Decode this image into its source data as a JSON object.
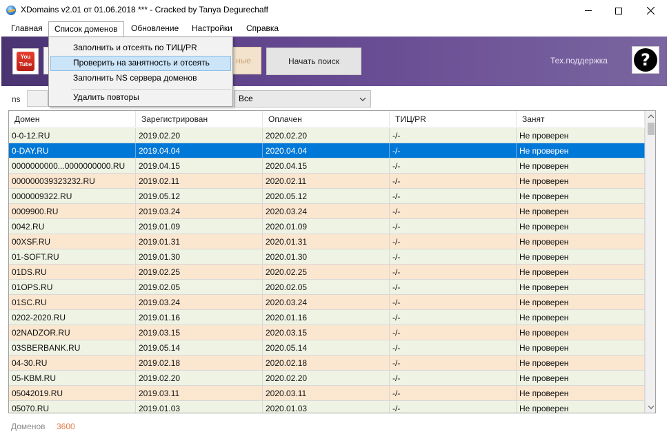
{
  "window": {
    "title": "XDomains v2.01 от 01.06.2018 *** - Cracked by Tanya Degurechaff"
  },
  "menubar": {
    "items": [
      "Главная",
      "Список доменов",
      "Обновление",
      "Настройки",
      "Справка"
    ],
    "active_index": 1
  },
  "dropdown": {
    "items": [
      "Заполнить и отсеять по ТИЦ/PR",
      "Проверить на занятность и отсеять",
      "Заполнить NS сервера доменов",
      "Удалить повторы"
    ],
    "hover_index": 1
  },
  "toolbar": {
    "partial_button_label": "ные",
    "search_button_label": "Начать поиск",
    "support_label": "Тех.поддержка",
    "help_icon": "?"
  },
  "filter": {
    "label": "ns",
    "select_value": "Все"
  },
  "table": {
    "headers": [
      "Домен",
      "Зарегистрирован",
      "Оплачен",
      "ТИЦ/PR",
      "Занят"
    ],
    "selected_index": 1,
    "rows": [
      {
        "domain": "0-0-12.RU",
        "registered": "2019.02.20",
        "paid": "2020.02.20",
        "tic": "-/-",
        "busy": "Не проверен",
        "tone": "green"
      },
      {
        "domain": "0-DAY.RU",
        "registered": "2019.04.04",
        "paid": "2020.04.04",
        "tic": "-/-",
        "busy": "Не проверен",
        "tone": "selected"
      },
      {
        "domain": "0000000000...0000000000.RU",
        "registered": "2019.04.15",
        "paid": "2020.04.15",
        "tic": "-/-",
        "busy": "Не проверен",
        "tone": "green"
      },
      {
        "domain": "000000039323232.RU",
        "registered": "2019.02.11",
        "paid": "2020.02.11",
        "tic": "-/-",
        "busy": "Не проверен",
        "tone": "orange"
      },
      {
        "domain": "0000009322.RU",
        "registered": "2019.05.12",
        "paid": "2020.05.12",
        "tic": "-/-",
        "busy": "Не проверен",
        "tone": "green"
      },
      {
        "domain": "0009900.RU",
        "registered": "2019.03.24",
        "paid": "2020.03.24",
        "tic": "-/-",
        "busy": "Не проверен",
        "tone": "orange"
      },
      {
        "domain": "0042.RU",
        "registered": "2019.01.09",
        "paid": "2020.01.09",
        "tic": "-/-",
        "busy": "Не проверен",
        "tone": "green"
      },
      {
        "domain": "00XSF.RU",
        "registered": "2019.01.31",
        "paid": "2020.01.31",
        "tic": "-/-",
        "busy": "Не проверен",
        "tone": "orange"
      },
      {
        "domain": "01-SOFT.RU",
        "registered": "2019.01.30",
        "paid": "2020.01.30",
        "tic": "-/-",
        "busy": "Не проверен",
        "tone": "green"
      },
      {
        "domain": "01DS.RU",
        "registered": "2019.02.25",
        "paid": "2020.02.25",
        "tic": "-/-",
        "busy": "Не проверен",
        "tone": "orange"
      },
      {
        "domain": "01OPS.RU",
        "registered": "2019.02.05",
        "paid": "2020.02.05",
        "tic": "-/-",
        "busy": "Не проверен",
        "tone": "green"
      },
      {
        "domain": "01SC.RU",
        "registered": "2019.03.24",
        "paid": "2020.03.24",
        "tic": "-/-",
        "busy": "Не проверен",
        "tone": "orange"
      },
      {
        "domain": "0202-2020.RU",
        "registered": "2019.01.16",
        "paid": "2020.01.16",
        "tic": "-/-",
        "busy": "Не проверен",
        "tone": "green"
      },
      {
        "domain": "02NADZOR.RU",
        "registered": "2019.03.15",
        "paid": "2020.03.15",
        "tic": "-/-",
        "busy": "Не проверен",
        "tone": "orange"
      },
      {
        "domain": "03SBERBANK.RU",
        "registered": "2019.05.14",
        "paid": "2020.05.14",
        "tic": "-/-",
        "busy": "Не проверен",
        "tone": "green"
      },
      {
        "domain": "04-30.RU",
        "registered": "2019.02.18",
        "paid": "2020.02.18",
        "tic": "-/-",
        "busy": "Не проверен",
        "tone": "orange"
      },
      {
        "domain": "05-KBM.RU",
        "registered": "2019.02.20",
        "paid": "2020.02.20",
        "tic": "-/-",
        "busy": "Не проверен",
        "tone": "green"
      },
      {
        "domain": "05042019.RU",
        "registered": "2019.03.11",
        "paid": "2020.03.11",
        "tic": "-/-",
        "busy": "Не проверен",
        "tone": "orange"
      },
      {
        "domain": "05070.RU",
        "registered": "2019.01.03",
        "paid": "2020.01.03",
        "tic": "-/-",
        "busy": "Не проверен",
        "tone": "green"
      }
    ]
  },
  "status": {
    "domains_label": "Доменов",
    "domains_count": "3600"
  },
  "colors": {
    "selected_row": "#0078d7",
    "row_green": "#eef3e4",
    "row_orange": "#fbe6d0",
    "toolbar_purple": "#5b3f88",
    "count_accent": "#e07a4a"
  }
}
